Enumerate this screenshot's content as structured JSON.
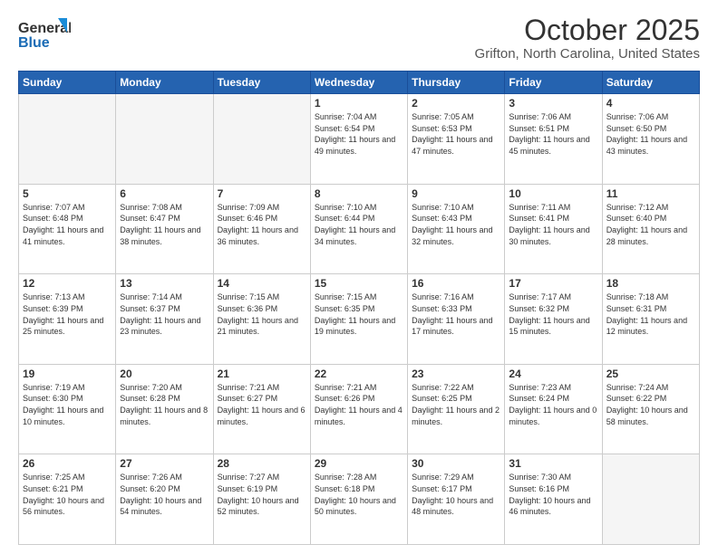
{
  "header": {
    "logo_line1": "General",
    "logo_line2": "Blue",
    "title": "October 2025",
    "subtitle": "Grifton, North Carolina, United States"
  },
  "days_of_week": [
    "Sunday",
    "Monday",
    "Tuesday",
    "Wednesday",
    "Thursday",
    "Friday",
    "Saturday"
  ],
  "weeks": [
    [
      {
        "day": "",
        "empty": true
      },
      {
        "day": "",
        "empty": true
      },
      {
        "day": "",
        "empty": true
      },
      {
        "day": "1",
        "sunrise": "7:04 AM",
        "sunset": "6:54 PM",
        "daylight": "11 hours and 49 minutes."
      },
      {
        "day": "2",
        "sunrise": "7:05 AM",
        "sunset": "6:53 PM",
        "daylight": "11 hours and 47 minutes."
      },
      {
        "day": "3",
        "sunrise": "7:06 AM",
        "sunset": "6:51 PM",
        "daylight": "11 hours and 45 minutes."
      },
      {
        "day": "4",
        "sunrise": "7:06 AM",
        "sunset": "6:50 PM",
        "daylight": "11 hours and 43 minutes."
      }
    ],
    [
      {
        "day": "5",
        "sunrise": "7:07 AM",
        "sunset": "6:48 PM",
        "daylight": "11 hours and 41 minutes."
      },
      {
        "day": "6",
        "sunrise": "7:08 AM",
        "sunset": "6:47 PM",
        "daylight": "11 hours and 38 minutes."
      },
      {
        "day": "7",
        "sunrise": "7:09 AM",
        "sunset": "6:46 PM",
        "daylight": "11 hours and 36 minutes."
      },
      {
        "day": "8",
        "sunrise": "7:10 AM",
        "sunset": "6:44 PM",
        "daylight": "11 hours and 34 minutes."
      },
      {
        "day": "9",
        "sunrise": "7:10 AM",
        "sunset": "6:43 PM",
        "daylight": "11 hours and 32 minutes."
      },
      {
        "day": "10",
        "sunrise": "7:11 AM",
        "sunset": "6:41 PM",
        "daylight": "11 hours and 30 minutes."
      },
      {
        "day": "11",
        "sunrise": "7:12 AM",
        "sunset": "6:40 PM",
        "daylight": "11 hours and 28 minutes."
      }
    ],
    [
      {
        "day": "12",
        "sunrise": "7:13 AM",
        "sunset": "6:39 PM",
        "daylight": "11 hours and 25 minutes."
      },
      {
        "day": "13",
        "sunrise": "7:14 AM",
        "sunset": "6:37 PM",
        "daylight": "11 hours and 23 minutes."
      },
      {
        "day": "14",
        "sunrise": "7:15 AM",
        "sunset": "6:36 PM",
        "daylight": "11 hours and 21 minutes."
      },
      {
        "day": "15",
        "sunrise": "7:15 AM",
        "sunset": "6:35 PM",
        "daylight": "11 hours and 19 minutes."
      },
      {
        "day": "16",
        "sunrise": "7:16 AM",
        "sunset": "6:33 PM",
        "daylight": "11 hours and 17 minutes."
      },
      {
        "day": "17",
        "sunrise": "7:17 AM",
        "sunset": "6:32 PM",
        "daylight": "11 hours and 15 minutes."
      },
      {
        "day": "18",
        "sunrise": "7:18 AM",
        "sunset": "6:31 PM",
        "daylight": "11 hours and 12 minutes."
      }
    ],
    [
      {
        "day": "19",
        "sunrise": "7:19 AM",
        "sunset": "6:30 PM",
        "daylight": "11 hours and 10 minutes."
      },
      {
        "day": "20",
        "sunrise": "7:20 AM",
        "sunset": "6:28 PM",
        "daylight": "11 hours and 8 minutes."
      },
      {
        "day": "21",
        "sunrise": "7:21 AM",
        "sunset": "6:27 PM",
        "daylight": "11 hours and 6 minutes."
      },
      {
        "day": "22",
        "sunrise": "7:21 AM",
        "sunset": "6:26 PM",
        "daylight": "11 hours and 4 minutes."
      },
      {
        "day": "23",
        "sunrise": "7:22 AM",
        "sunset": "6:25 PM",
        "daylight": "11 hours and 2 minutes."
      },
      {
        "day": "24",
        "sunrise": "7:23 AM",
        "sunset": "6:24 PM",
        "daylight": "11 hours and 0 minutes."
      },
      {
        "day": "25",
        "sunrise": "7:24 AM",
        "sunset": "6:22 PM",
        "daylight": "10 hours and 58 minutes."
      }
    ],
    [
      {
        "day": "26",
        "sunrise": "7:25 AM",
        "sunset": "6:21 PM",
        "daylight": "10 hours and 56 minutes."
      },
      {
        "day": "27",
        "sunrise": "7:26 AM",
        "sunset": "6:20 PM",
        "daylight": "10 hours and 54 minutes."
      },
      {
        "day": "28",
        "sunrise": "7:27 AM",
        "sunset": "6:19 PM",
        "daylight": "10 hours and 52 minutes."
      },
      {
        "day": "29",
        "sunrise": "7:28 AM",
        "sunset": "6:18 PM",
        "daylight": "10 hours and 50 minutes."
      },
      {
        "day": "30",
        "sunrise": "7:29 AM",
        "sunset": "6:17 PM",
        "daylight": "10 hours and 48 minutes."
      },
      {
        "day": "31",
        "sunrise": "7:30 AM",
        "sunset": "6:16 PM",
        "daylight": "10 hours and 46 minutes."
      },
      {
        "day": "",
        "empty": true
      }
    ]
  ]
}
